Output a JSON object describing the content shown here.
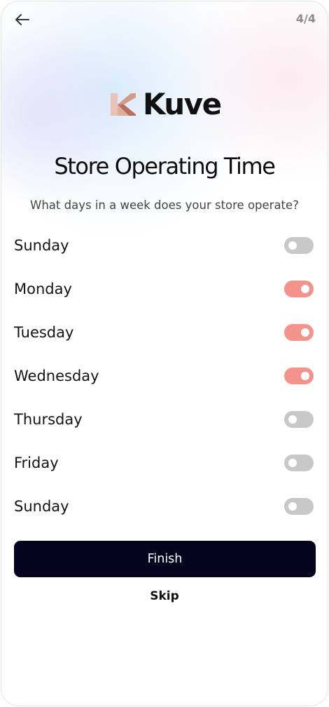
{
  "header": {
    "back_icon": "arrow-left-icon",
    "step_counter": "4/4"
  },
  "brand": {
    "name": "Kuve",
    "logo_colors": [
      "#e8c2b4",
      "#d39a88",
      "#b86f60"
    ]
  },
  "title": "Store Operating Time",
  "subtitle": "What days in a week does your store operate?",
  "days": [
    {
      "label": "Sunday",
      "enabled": false
    },
    {
      "label": "Monday",
      "enabled": true
    },
    {
      "label": "Tuesday",
      "enabled": true
    },
    {
      "label": "Wednesday",
      "enabled": true
    },
    {
      "label": "Thursday",
      "enabled": false
    },
    {
      "label": "Friday",
      "enabled": false
    },
    {
      "label": "Sunday",
      "enabled": false
    }
  ],
  "actions": {
    "finish_label": "Finish",
    "skip_label": "Skip"
  },
  "colors": {
    "toggle_on": "#f3938c",
    "toggle_off": "#c8c8c8",
    "primary_button": "#04041e"
  }
}
